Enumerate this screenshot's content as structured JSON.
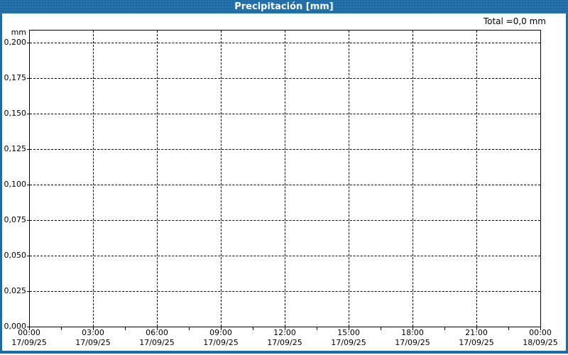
{
  "window": {
    "title": "Precipitación [mm]"
  },
  "summary": {
    "total_label": "Total =0,0 mm"
  },
  "colors": {
    "frame_blue": "#1e6ca6",
    "plot_border": "#000000",
    "grid": "#000000",
    "background": "#ffffff",
    "title_text": "#ffffff",
    "label_text": "#000000"
  },
  "chart_data": {
    "type": "bar",
    "title": "Precipitación [mm]",
    "xlabel": "",
    "ylabel": "mm",
    "ylim": [
      0,
      0.209
    ],
    "grid": "dashed-both-axes",
    "legend": "none",
    "y_tick_labels": [
      "0,000",
      "0,025",
      "0,050",
      "0,075",
      "0,100",
      "0,125",
      "0,150",
      "0,175",
      "0,200"
    ],
    "y_tick_values": [
      0,
      0.025,
      0.05,
      0.075,
      0.1,
      0.125,
      0.15,
      0.175,
      0.2
    ],
    "x_tick_labels": [
      {
        "time": "00:00",
        "date": "17/09/25"
      },
      {
        "time": "03:00",
        "date": "17/09/25"
      },
      {
        "time": "06:00",
        "date": "17/09/25"
      },
      {
        "time": "09:00",
        "date": "17/09/25"
      },
      {
        "time": "12:00",
        "date": "17/09/25"
      },
      {
        "time": "15:00",
        "date": "17/09/25"
      },
      {
        "time": "18:00",
        "date": "17/09/25"
      },
      {
        "time": "21:00",
        "date": "17/09/25"
      },
      {
        "time": "00:00",
        "date": "18/09/25"
      }
    ],
    "x_minor_ticks_between_labels": 1,
    "series": [
      {
        "name": "Precipitación",
        "values": []
      }
    ],
    "total_mm": 0.0,
    "total_annotation": "Total =0,0 mm"
  }
}
